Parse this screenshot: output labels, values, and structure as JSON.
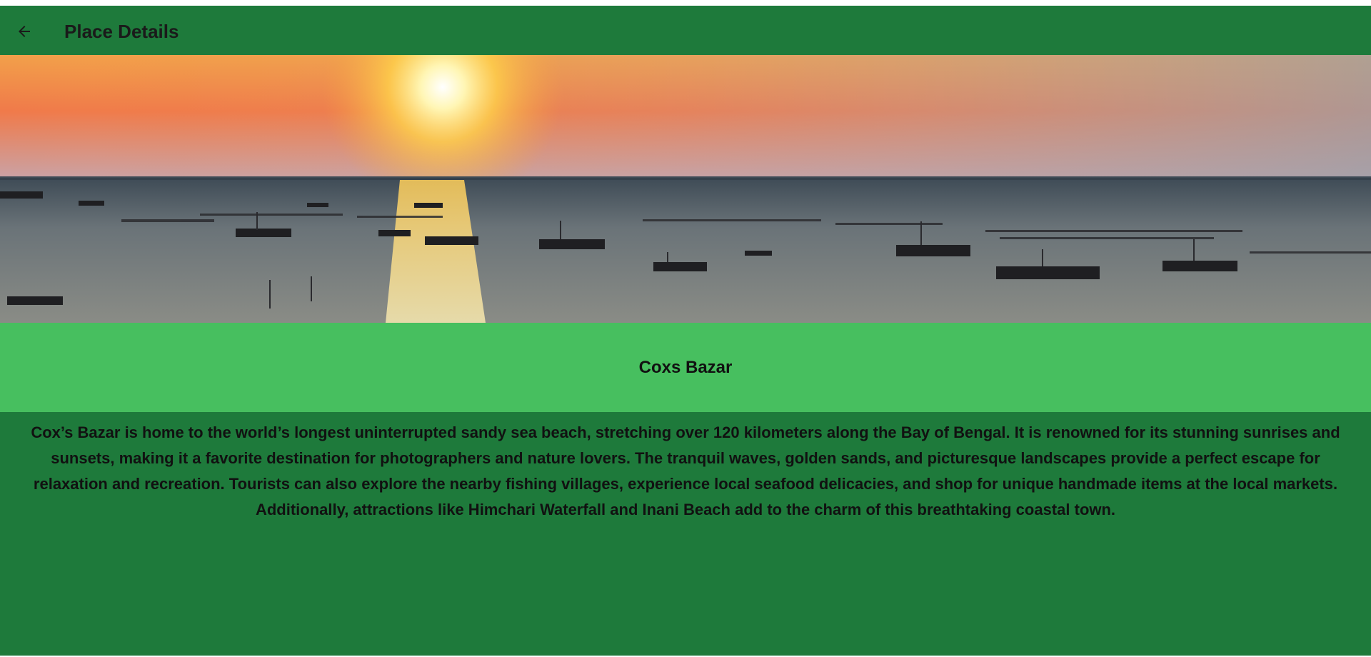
{
  "appbar": {
    "title": "Place Details",
    "back_icon": "arrow-left-icon"
  },
  "hero": {
    "alt": "Sunset over the sea with fishing boats"
  },
  "place": {
    "name": "Coxs Bazar",
    "description": "Cox’s Bazar is home to the world’s longest uninterrupted sandy sea beach, stretching over 120 kilometers along the Bay of Bengal. It is renowned for its stunning sunrises and sunsets, making it a favorite destination for photographers and nature lovers. The tranquil waves, golden sands, and picturesque landscapes provide a perfect escape for relaxation and recreation. Tourists can also explore the nearby fishing villages, experience local seafood delicacies, and shop for unique handmade items at the local markets. Additionally, attractions like Himchari Waterfall and Inani Beach add to the charm of this breathtaking coastal town."
  },
  "colors": {
    "appbar": "#1e7a3b",
    "title_band": "#47bf5f",
    "text": "#111111"
  }
}
